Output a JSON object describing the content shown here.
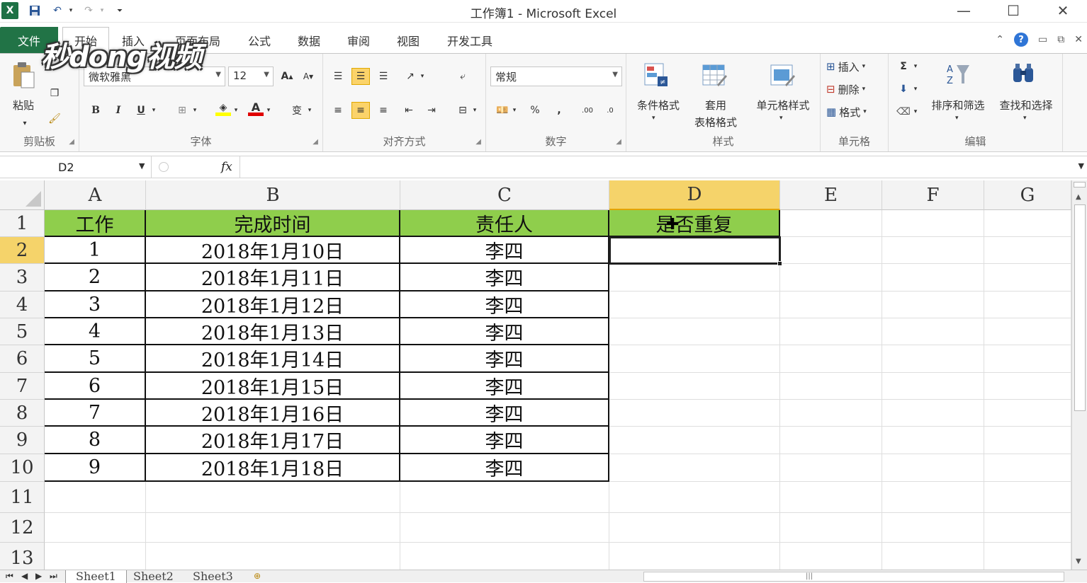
{
  "window": {
    "title": "工作簿1 - Microsoft Excel",
    "app_icon_letter": "X",
    "minimize_glyph": "—",
    "maximize_glyph": "☐",
    "close_glyph": "✕"
  },
  "quick_access": {
    "save_icon": "save-icon",
    "undo_icon": "undo-icon",
    "redo_icon": "redo-icon",
    "customize_icon": "customize-icon"
  },
  "ribbon_tabs": [
    "文件",
    "开始",
    "插入",
    "页面布局",
    "公式",
    "数据",
    "审阅",
    "视图",
    "开发工具"
  ],
  "ribbon": {
    "clipboard": {
      "paste": "粘贴",
      "label": "剪贴板"
    },
    "font": {
      "name": "微软雅黑",
      "size": "12",
      "bold": "B",
      "italic": "I",
      "underline": "U",
      "grow": "A",
      "shrink": "A",
      "font_color_letter": "A",
      "phonetic": "变",
      "label": "字体"
    },
    "alignment": {
      "label": "对齐方式"
    },
    "number": {
      "format": "常规",
      "percent": "%",
      "comma": ",",
      "inc_decimal": ".00",
      "dec_decimal": ".0",
      "label": "数字"
    },
    "styles": {
      "conditional": "条件格式",
      "table_line1": "套用",
      "table_line2": "表格格式",
      "cell_styles": "单元格样式",
      "label": "样式"
    },
    "cells": {
      "insert": "插入",
      "delete": "删除",
      "format": "格式",
      "label": "单元格"
    },
    "editing": {
      "sigma": "Σ",
      "sort": "排序和筛选",
      "find": "查找和选择",
      "label": "编辑"
    }
  },
  "formula_bar": {
    "name_box": "D2",
    "fx": "fx",
    "formula": ""
  },
  "columns": [
    "A",
    "B",
    "C",
    "D",
    "E",
    "F",
    "G"
  ],
  "rows": [
    "1",
    "2",
    "3",
    "4",
    "5",
    "6",
    "7",
    "8",
    "9",
    "10",
    "11",
    "12",
    "13"
  ],
  "sheet": {
    "header": [
      "工作",
      "完成时间",
      "责任人",
      "是否重复"
    ],
    "data": [
      [
        "1",
        "2018年1月10日",
        "李四"
      ],
      [
        "2",
        "2018年1月11日",
        "李四"
      ],
      [
        "3",
        "2018年1月12日",
        "李四"
      ],
      [
        "4",
        "2018年1月13日",
        "李四"
      ],
      [
        "5",
        "2018年1月14日",
        "李四"
      ],
      [
        "6",
        "2018年1月15日",
        "李四"
      ],
      [
        "7",
        "2018年1月16日",
        "李四"
      ],
      [
        "8",
        "2018年1月17日",
        "李四"
      ],
      [
        "9",
        "2018年1月18日",
        "李四"
      ]
    ],
    "active_cell": "D2",
    "header_fill": "#8fce4c"
  },
  "sheet_tabs": [
    "Sheet1",
    "Sheet2",
    "Sheet3"
  ],
  "watermark": "秒dong视频",
  "colors": {
    "accent": "#217346",
    "selection_header": "#f5d36a"
  }
}
